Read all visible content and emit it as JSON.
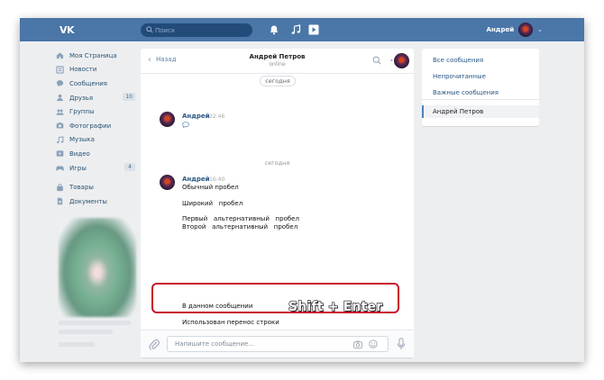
{
  "topbar": {
    "logo": "VK",
    "search_placeholder": "Поиск",
    "user_name": "Андрей"
  },
  "sidebar": {
    "items": [
      {
        "label": "Моя Страница",
        "icon": "home-icon"
      },
      {
        "label": "Новости",
        "icon": "news-icon"
      },
      {
        "label": "Сообщения",
        "icon": "messages-icon"
      },
      {
        "label": "Друзья",
        "icon": "friends-icon",
        "badge": "10"
      },
      {
        "label": "Группы",
        "icon": "groups-icon"
      },
      {
        "label": "Фотографии",
        "icon": "camera-icon"
      },
      {
        "label": "Музыка",
        "icon": "music-icon"
      },
      {
        "label": "Видео",
        "icon": "video-icon"
      },
      {
        "label": "Игры",
        "icon": "games-icon",
        "badge": "4"
      }
    ],
    "items2": [
      {
        "label": "Товары",
        "icon": "bag-icon"
      },
      {
        "label": "Документы",
        "icon": "document-icon"
      }
    ]
  },
  "chat": {
    "back_label": "Назад",
    "name": "Андрей Петров",
    "status": "online",
    "date_pill": "сегодня",
    "date_divider": "сегодня",
    "msg1": {
      "author": "Андрей",
      "time": "22:46"
    },
    "msg2": {
      "author": "Андрей",
      "time": "16:40",
      "lines": [
        "Обычный пробел",
        "Широкий   пробел",
        "Первый   альтернативный   пробел",
        "Второй   альтернативный   пробел",
        "В данном сообщении",
        "Использован перенос строки"
      ]
    },
    "shortcut_overlay": "Shift + Enter",
    "composer_placeholder": "Напишите сообщение..."
  },
  "right_panel": {
    "items": [
      "Все сообщения",
      "Непрочитанные",
      "Важные сообщения"
    ],
    "active": "Андрей Петров"
  },
  "colors": {
    "header": "#4a76a8",
    "link": "#2a5885",
    "highlight": "#c8102e"
  }
}
